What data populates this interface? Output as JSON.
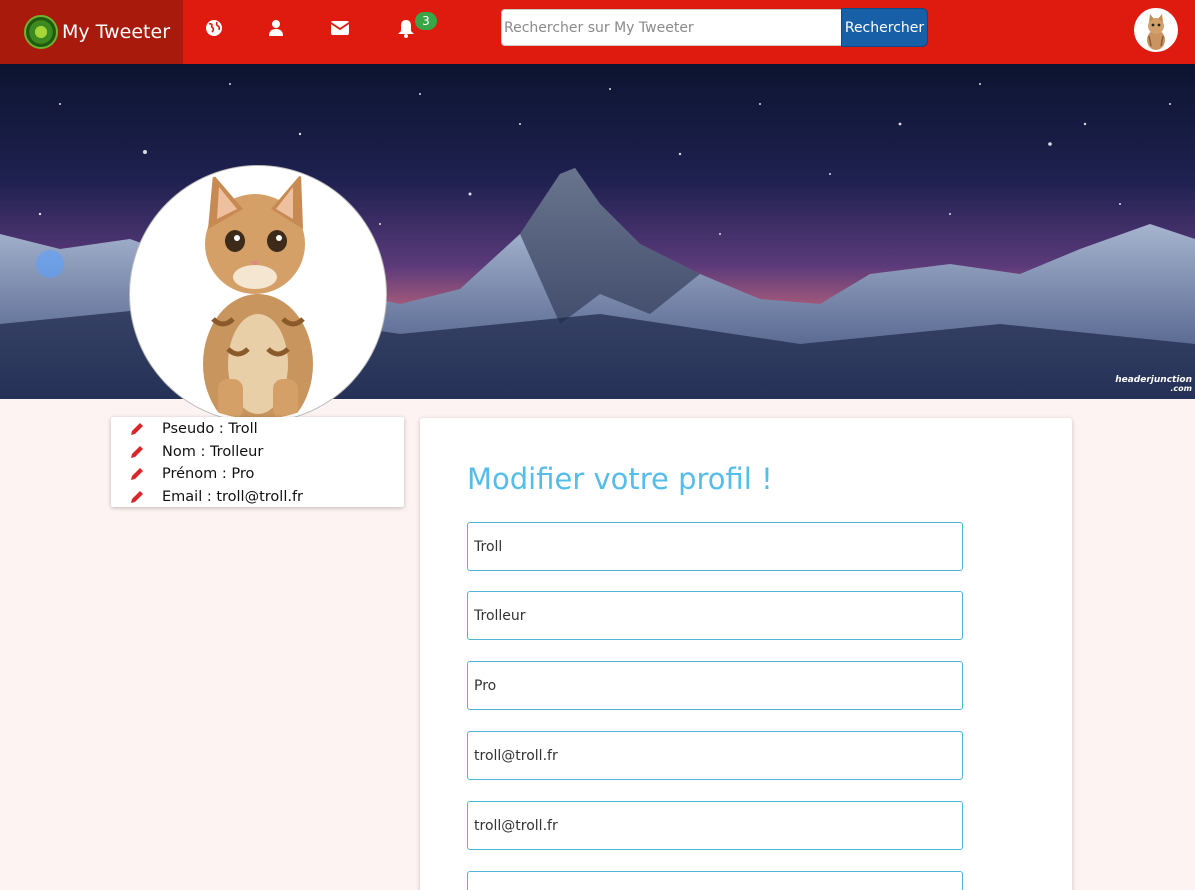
{
  "navbar": {
    "brand": "My Tweeter",
    "icons": [
      "globe-icon",
      "user-icon",
      "envelope-icon",
      "bell-icon"
    ],
    "notification_count": "3",
    "search_placeholder": "Rechercher sur My Tweeter",
    "search_button": "Rechercher"
  },
  "banner": {
    "watermark": "headerjunction",
    "watermark_sub": ".com"
  },
  "info": {
    "items": [
      {
        "label": "Pseudo : Troll"
      },
      {
        "label": "Nom : Trolleur"
      },
      {
        "label": "Prénom : Pro"
      },
      {
        "label": "Email : troll@troll.fr"
      }
    ]
  },
  "edit": {
    "title": "Modifier votre profil !",
    "fields": [
      {
        "value": "Troll"
      },
      {
        "value": "Trolleur"
      },
      {
        "value": "Pro"
      },
      {
        "value": "troll@troll.fr"
      },
      {
        "value": "troll@troll.fr"
      },
      {
        "value": ""
      }
    ]
  },
  "colors": {
    "navbar": "#df1a0f",
    "brand_bg": "#a81a0c",
    "search_button": "#1760a7",
    "badge": "#3aa546",
    "title": "#55bde9",
    "field_border": "#4fb6d6",
    "pencil": "#d9262a"
  }
}
